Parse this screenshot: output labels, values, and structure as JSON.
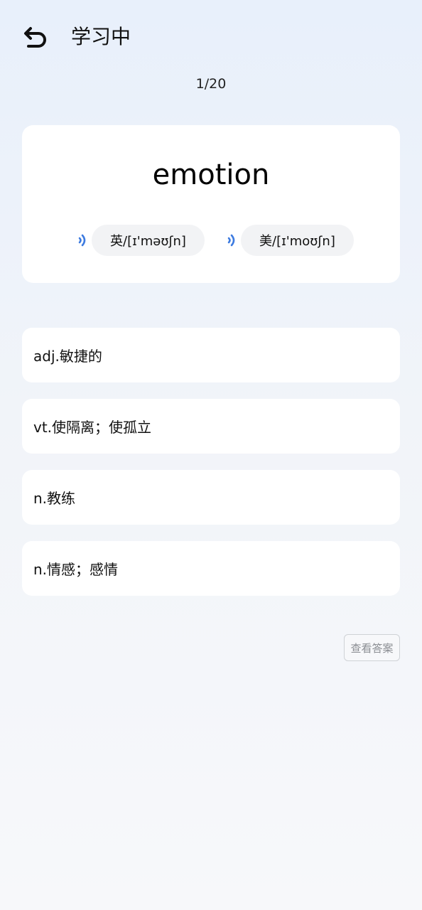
{
  "header": {
    "back_icon": "undo-arrow-icon",
    "title": "学习中"
  },
  "progress": "1/20",
  "word_card": {
    "word": "emotion",
    "speaker_icon": "speaker-wave-icon",
    "accent_color": "#3d7be0",
    "uk_phonetic": "英/[ɪ'məʊʃn]",
    "us_phonetic": "美/[ɪ'moʊʃn]"
  },
  "options": [
    {
      "label": "adj.敏捷的"
    },
    {
      "label": "vt.使隔离；使孤立"
    },
    {
      "label": "n.教练"
    },
    {
      "label": "n.情感；感情"
    }
  ],
  "show_answer_label": "查看答案"
}
